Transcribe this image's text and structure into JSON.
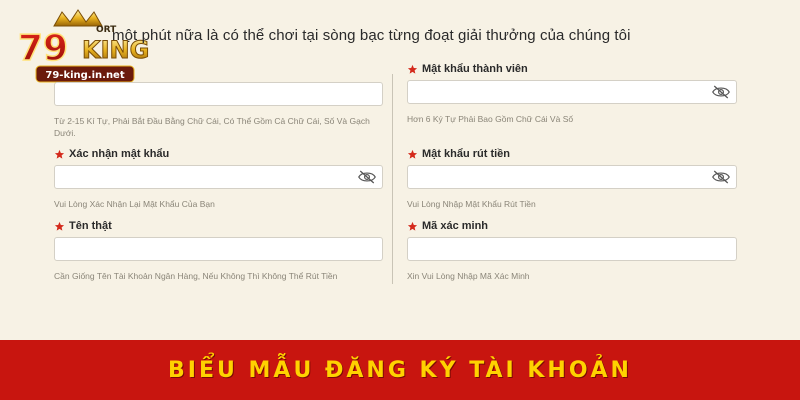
{
  "logo": {
    "number": "79",
    "word": "KING",
    "small": "ORT",
    "domain": "79-king.in.net"
  },
  "headline": "một phút nữa là có thể chơi tại sòng bạc từng đoạt giải thưởng của chúng tôi",
  "form": {
    "left": [
      {
        "label": "",
        "value": "",
        "hint": "Từ 2-15 Kí Tự, Phải Bắt Đầu Bằng Chữ Cái, Có Thể Gồm Cả Chữ Cái, Số Và Gạch Dưới."
      },
      {
        "label": "Xác nhận mật khẩu",
        "value": "",
        "hint": "Vui Lòng Xác Nhận Lại Mật Khẩu Của Bạn"
      },
      {
        "label": "Tên thật",
        "value": "",
        "hint": "Cần Giống Tên Tài Khoản Ngân Hàng, Nếu Không Thì Không Thể Rút Tiền"
      }
    ],
    "right": [
      {
        "label": "Mật khẩu thành viên",
        "value": "",
        "hint": "Hơn 6 Ký Tự Phải Bao Gồm Chữ Cái Và Số"
      },
      {
        "label": "Mật khẩu rút tiền",
        "value": "",
        "hint": "Vui Lòng Nhập Mật Khẩu Rút Tiền"
      },
      {
        "label": "Mã xác minh",
        "value": "",
        "hint": "Xin Vui Lòng Nhập Mã Xác Minh"
      }
    ]
  },
  "icons": {
    "required": "star-icon",
    "toggle_visibility": "eye-off-icon"
  },
  "banner": {
    "text": "BIỂU MẪU ĐĂNG KÝ TÀI KHOẢN"
  },
  "colors": {
    "page_bg": "#f7f2e5",
    "banner_bg": "#c8150f",
    "banner_text": "#ffd200",
    "required_star": "#d42a1c"
  }
}
